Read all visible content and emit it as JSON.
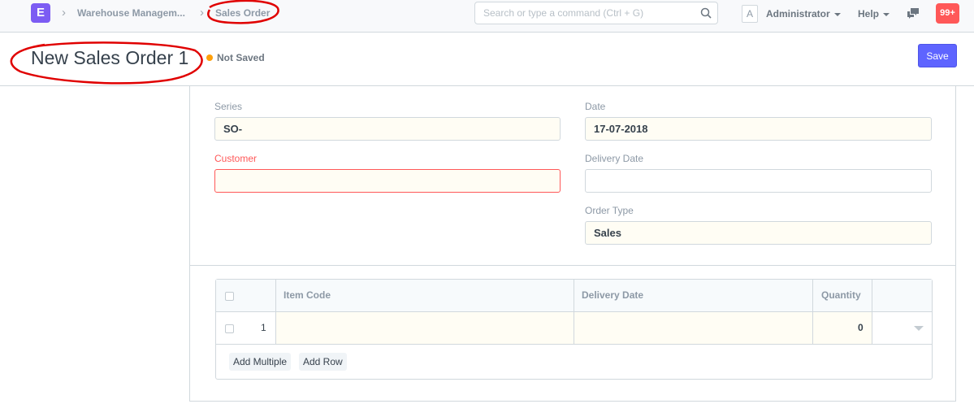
{
  "app": {
    "logo_letter": "E"
  },
  "breadcrumbs": [
    {
      "label": "Warehouse Managem..."
    },
    {
      "label": "Sales Order"
    }
  ],
  "search": {
    "placeholder": "Search or type a command (Ctrl + G)"
  },
  "user": {
    "avatar_letter": "A",
    "name": "Administrator"
  },
  "help": {
    "label": "Help"
  },
  "notifications": {
    "count": "99+"
  },
  "page": {
    "title": "New Sales Order 1",
    "status": "Not Saved",
    "save_label": "Save"
  },
  "form": {
    "series": {
      "label": "Series",
      "value": "SO-"
    },
    "customer": {
      "label": "Customer",
      "value": ""
    },
    "date": {
      "label": "Date",
      "value": "17-07-2018"
    },
    "delivery_date": {
      "label": "Delivery Date",
      "value": ""
    },
    "order_type": {
      "label": "Order Type",
      "value": "Sales"
    }
  },
  "items_grid": {
    "columns": [
      "Item Code",
      "Delivery Date",
      "Quantity"
    ],
    "rows": [
      {
        "idx": "1",
        "item_code": "",
        "delivery_date": "",
        "quantity": "0"
      }
    ],
    "add_multiple_label": "Add Multiple",
    "add_row_label": "Add Row"
  },
  "colors": {
    "brand": "#7c5cf3",
    "primary": "#5e64ff",
    "notification": "#ff5858",
    "status_dot": "#ffa00a",
    "annotation": "#e00000"
  }
}
